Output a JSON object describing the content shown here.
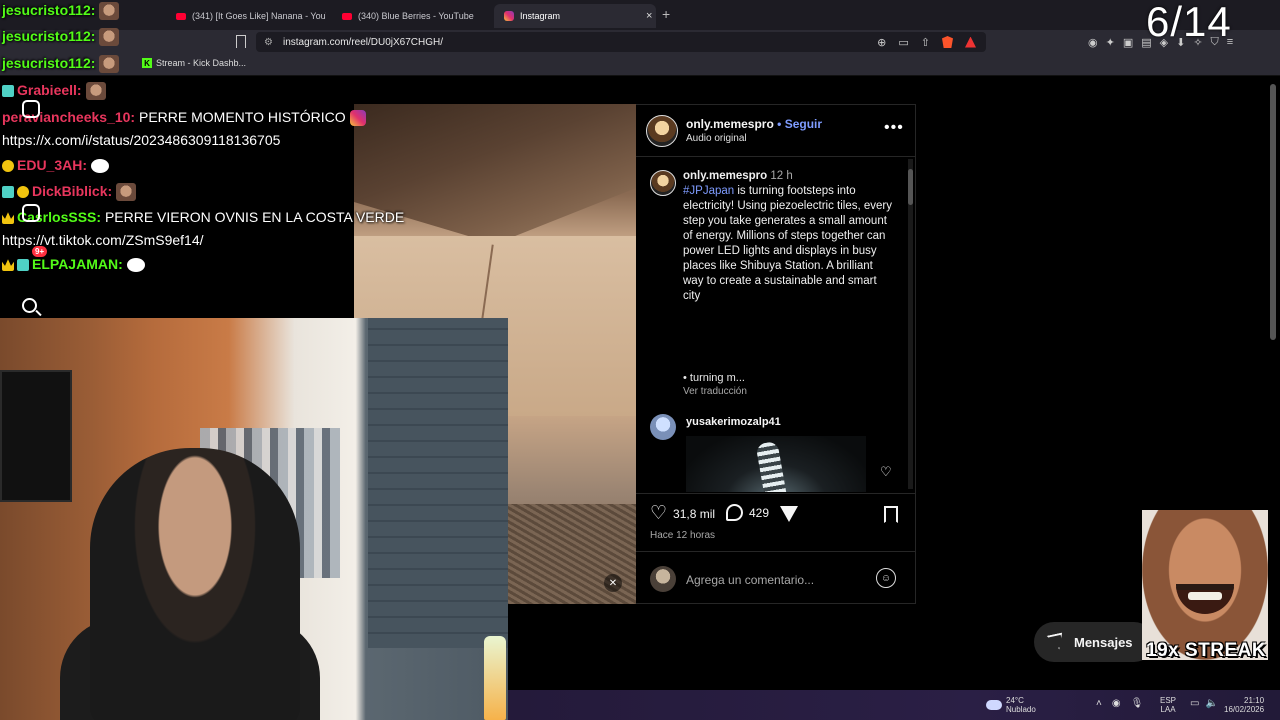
{
  "browser": {
    "tabs": [
      {
        "label": "(341) [It Goes Like] Nanana - YouTube",
        "icon": "youtube-icon"
      },
      {
        "label": "(340) Blue Berries - YouTube",
        "icon": "youtube-icon"
      },
      {
        "label": "Instagram",
        "icon": "instagram-icon",
        "active": true
      }
    ],
    "new_tab": "+",
    "tab_close": "×",
    "url": "instagram.com/reel/DU0jX67CHGH/",
    "bookmark_label": "Stream - Kick Dashb...",
    "bookmark_icon_letter": "K"
  },
  "counter": "6/14",
  "chat": {
    "lines": [
      {
        "user": "jesucristo112:",
        "message": "",
        "color": "#53fc18"
      },
      {
        "user": "jesucristo112:",
        "message": "",
        "color": "#53fc18"
      },
      {
        "user": "jesucristo112:",
        "message": "",
        "color": "#53fc18"
      },
      {
        "user": "Grabieell:",
        "message": "",
        "color": "#e8365d"
      },
      {
        "user": "peraviancheeks_10:",
        "message": "PERRE MOMENTO HISTÓRICO",
        "color": "#e8365d"
      },
      {
        "user": "",
        "message": "https://x.com/i/status/2023486309118136705",
        "color": "#ffffff"
      },
      {
        "user": "EDU_3AH:",
        "message": "",
        "color": "#e8365d"
      },
      {
        "user": "DickBiblick:",
        "message": "",
        "color": "#e8365d"
      },
      {
        "user": "CasrlosSSS:",
        "message": "PERRE VIERON OVNIS EN LA COSTA VERDE",
        "color": "#53fc18"
      },
      {
        "user": "",
        "message": "https://vt.tiktok.com/ZSmS9ef14/",
        "color": "#ffffff"
      },
      {
        "user": "ELPAJAMAN:",
        "message": "",
        "color": "#53fc18"
      }
    ],
    "notification_count": "9+"
  },
  "post": {
    "username": "only.memespro",
    "follow": "Seguir",
    "separator": "•",
    "audio": "Audio original",
    "more": "•••",
    "caption_time": "12 h",
    "hashtag": "#JPJapan",
    "caption_text": "is turning footsteps into electricity! Using piezoelectric tiles, every step you take generates a small amount of energy. Millions of steps together can power LED lights and displays in busy places like Shibuya Station. A brilliant way to create a sustainable and smart city",
    "caption_more": "• turning m...",
    "translate": "Ver traducción",
    "reply_user": "yusakerimozalp41",
    "likes": "31,8 mil",
    "comments_count": "429",
    "time_ago": "Hace 12 horas",
    "add_comment_placeholder": "Agrega un comentario..."
  },
  "messages_label": "Mensajes",
  "streak": "19x STREAK",
  "taskbar": {
    "temp": "24°C",
    "weather": "Nublado",
    "lang_top": "ESP",
    "lang_bottom": "LAA",
    "time": "21:10",
    "date": "16/02/2026"
  }
}
